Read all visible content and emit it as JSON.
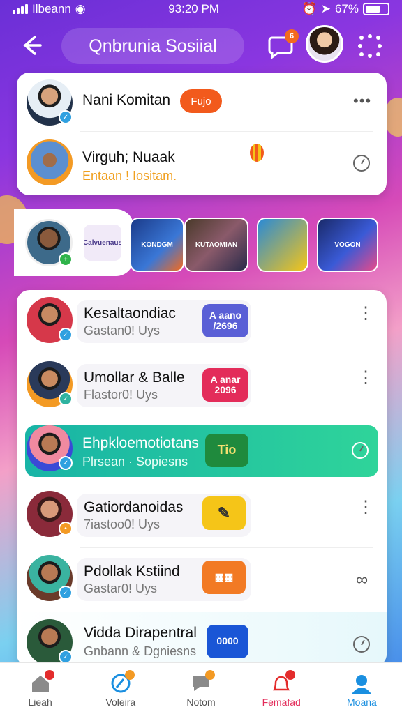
{
  "status_bar": {
    "carrier": "Ilbeann",
    "time": "93:20 PM",
    "battery": "67%",
    "battery_level": 0.67
  },
  "header": {
    "title": "Qnbrunia Sosiial",
    "chat_badge": "6"
  },
  "card_top": {
    "row1": {
      "name": "Nani Komitan",
      "pill": "Fujo"
    },
    "row2": {
      "name": "Virguh; Nuaak",
      "sub": "Entaan ! Iositam."
    }
  },
  "stories": [
    {
      "label": "Calvuenaus"
    },
    {
      "label": "KONDGM"
    },
    {
      "label": "KUTAOMIAN"
    },
    {
      "label": ""
    },
    {
      "label": "VOGON"
    }
  ],
  "list": [
    {
      "name": "Kesaltaondiac",
      "sub": "Gastan0! Uys",
      "tag": "A aano /2696",
      "color": "#5a5fd6"
    },
    {
      "name": "Umollar & Balle",
      "sub": "Flastor0! Uys",
      "tag": "A anar 2096",
      "color": "#e32c5a"
    },
    {
      "name": "Ehpkloemotiotans",
      "sub": "Plrsean · Sopiesns",
      "tag": "Tio",
      "color": "#1f8a3d"
    },
    {
      "name": "Gatiordanoidas",
      "sub": "7iastoo0! Uys",
      "tag": "",
      "color": "#f5c518"
    },
    {
      "name": "Pdollak Kstiind",
      "sub": "Gastar0! Uys",
      "tag": "",
      "color": "#f27a24"
    },
    {
      "name": "Vidda Dirapentral",
      "sub": "Gnbann & Dgniesns",
      "tag": "0000",
      "color": "#1a56d6"
    }
  ],
  "tabs": [
    {
      "label": "Lieah",
      "active": false
    },
    {
      "label": "Voleira",
      "active": false
    },
    {
      "label": "Notom",
      "active": false
    },
    {
      "label": "Femafad",
      "active": false
    },
    {
      "label": "Moana",
      "active": true
    }
  ],
  "colors": {
    "accent": "#1a8fe0",
    "orange": "#f36a1e",
    "teal": "#2fd49a"
  }
}
